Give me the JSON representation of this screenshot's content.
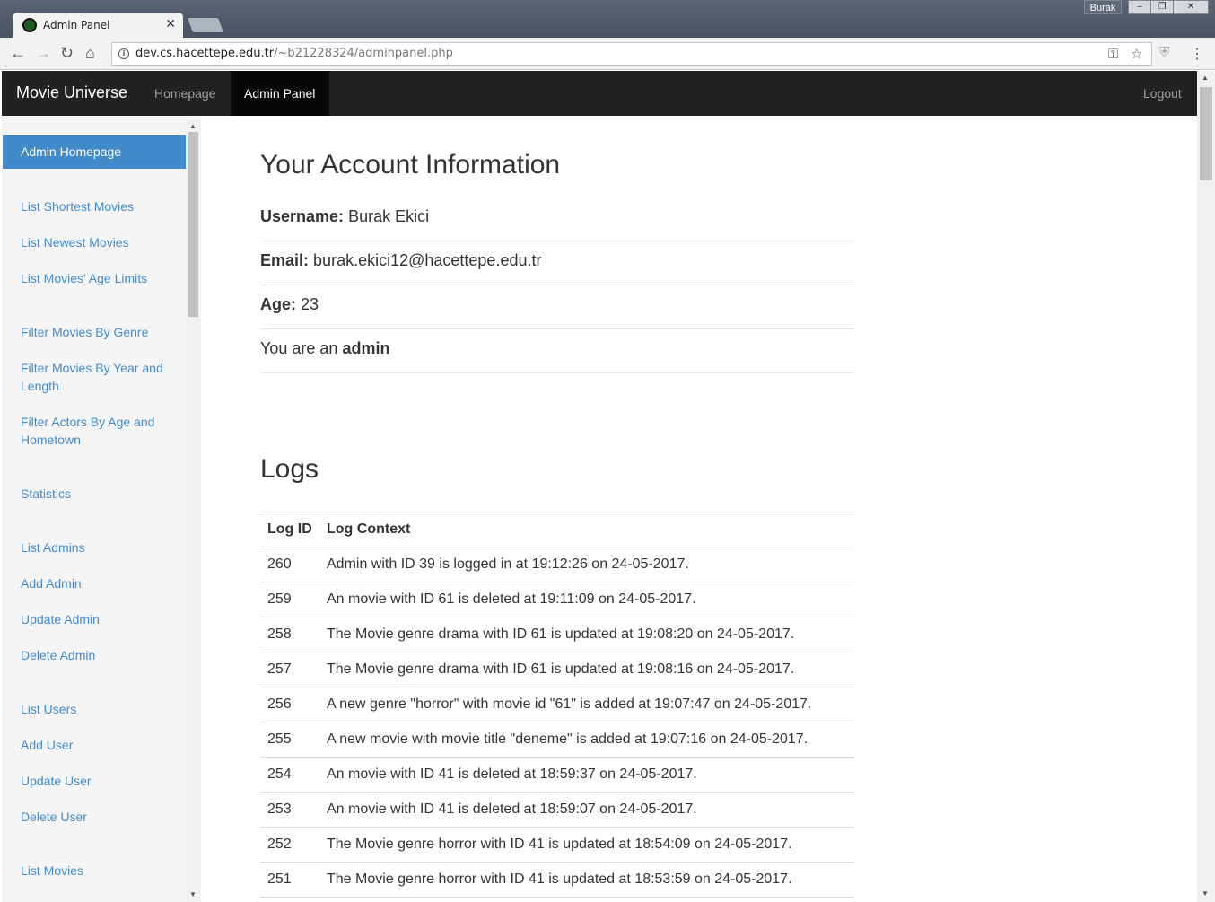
{
  "browser": {
    "tab_title": "Admin Panel",
    "profile_name": "Burak",
    "url_host": "dev.cs.hacettepe.edu.tr",
    "url_path": "/~b21228324/adminpanel.php"
  },
  "navbar": {
    "brand": "Movie Universe",
    "links": [
      "Homepage",
      "Admin Panel"
    ],
    "active": "Admin Panel",
    "logout": "Logout"
  },
  "sidebar": {
    "active_item": "Admin Homepage",
    "items": [
      "List Shortest Movies",
      "List Newest Movies",
      "List Movies' Age Limits",
      "Filter Movies By Genre",
      "Filter Movies By Year and Length",
      "Filter Actors By Age and Hometown",
      "Statistics",
      "List Admins",
      "Add Admin",
      "Update Admin",
      "Delete Admin",
      "List Users",
      "Add User",
      "Update User",
      "Delete User",
      "List Movies"
    ]
  },
  "account": {
    "heading": "Your Account Information",
    "username_label": "Username:",
    "username": "Burak Ekici",
    "email_label": "Email:",
    "email": "burak.ekici12@hacettepe.edu.tr",
    "age_label": "Age:",
    "age": "23",
    "role_prefix": "You are an",
    "role": "admin"
  },
  "logs": {
    "heading": "Logs",
    "columns": [
      "Log ID",
      "Log Context"
    ],
    "rows": [
      [
        "260",
        "Admin with ID 39 is logged in at 19:12:26 on 24-05-2017."
      ],
      [
        "259",
        "An movie with ID 61 is deleted at 19:11:09 on 24-05-2017."
      ],
      [
        "258",
        "The Movie genre drama with ID 61 is updated at 19:08:20 on 24-05-2017."
      ],
      [
        "257",
        "The Movie genre drama with ID 61 is updated at 19:08:16 on 24-05-2017."
      ],
      [
        "256",
        "A new genre \"horror\" with movie id \"61\" is added at 19:07:47 on 24-05-2017."
      ],
      [
        "255",
        "A new movie with movie title \"deneme\" is added at 19:07:16 on 24-05-2017."
      ],
      [
        "254",
        "An movie with ID 41 is deleted at 18:59:37 on 24-05-2017."
      ],
      [
        "253",
        "An movie with ID 41 is deleted at 18:59:07 on 24-05-2017."
      ],
      [
        "252",
        "The Movie genre horror with ID 41 is updated at 18:54:09 on 24-05-2017."
      ],
      [
        "251",
        "The Movie genre horror with ID 41 is updated at 18:53:59 on 24-05-2017."
      ]
    ]
  },
  "colors": {
    "navbar_bg": "#222222",
    "accent": "#428bca",
    "sidebar_bg": "#f5f5f5"
  }
}
